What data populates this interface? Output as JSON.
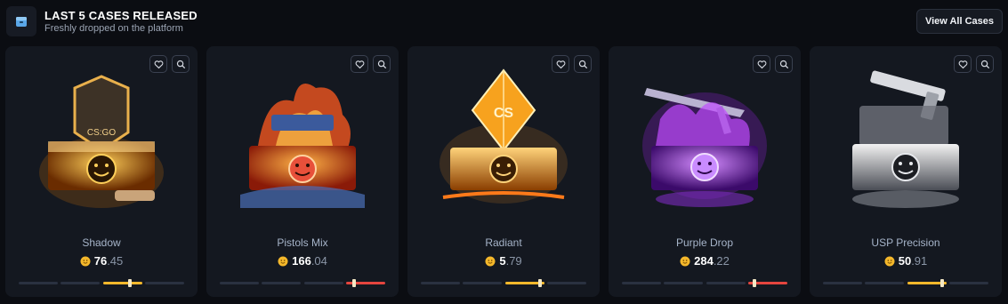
{
  "header": {
    "title": "LAST 5 CASES RELEASED",
    "subtitle": "Freshly dropped on the platform",
    "icon": "box-icon",
    "view_all_label": "View All Cases"
  },
  "colors": {
    "background": "#0b0d12",
    "card": "#141820",
    "segment_inactive": "#2a3140",
    "price_decimal": "#8b96a7"
  },
  "cases": [
    {
      "name": "Shadow",
      "price_int": "76",
      "price_dec": ".45",
      "risk_segment": 3,
      "risk_level": 0.7,
      "risk_color": "#f5b82b",
      "art_theme": "golden-chest"
    },
    {
      "name": "Pistols Mix",
      "price_int": "166",
      "price_dec": ".04",
      "risk_segment": 4,
      "risk_level": 0.2,
      "risk_color": "#e5453e",
      "art_theme": "fiery-chest"
    },
    {
      "name": "Radiant",
      "price_int": "5",
      "price_dec": ".79",
      "risk_segment": 3,
      "risk_level": 0.9,
      "risk_color": "#f5b82b",
      "art_theme": "orange-crystal-chest"
    },
    {
      "name": "Purple Drop",
      "price_int": "284",
      "price_dec": ".22",
      "risk_segment": 4,
      "risk_level": 0.15,
      "risk_color": "#e5453e",
      "art_theme": "purple-chest"
    },
    {
      "name": "USP Precision",
      "price_int": "50",
      "price_dec": ".91",
      "risk_segment": 3,
      "risk_level": 0.9,
      "risk_color": "#f5b82b",
      "art_theme": "silver-chest"
    }
  ]
}
